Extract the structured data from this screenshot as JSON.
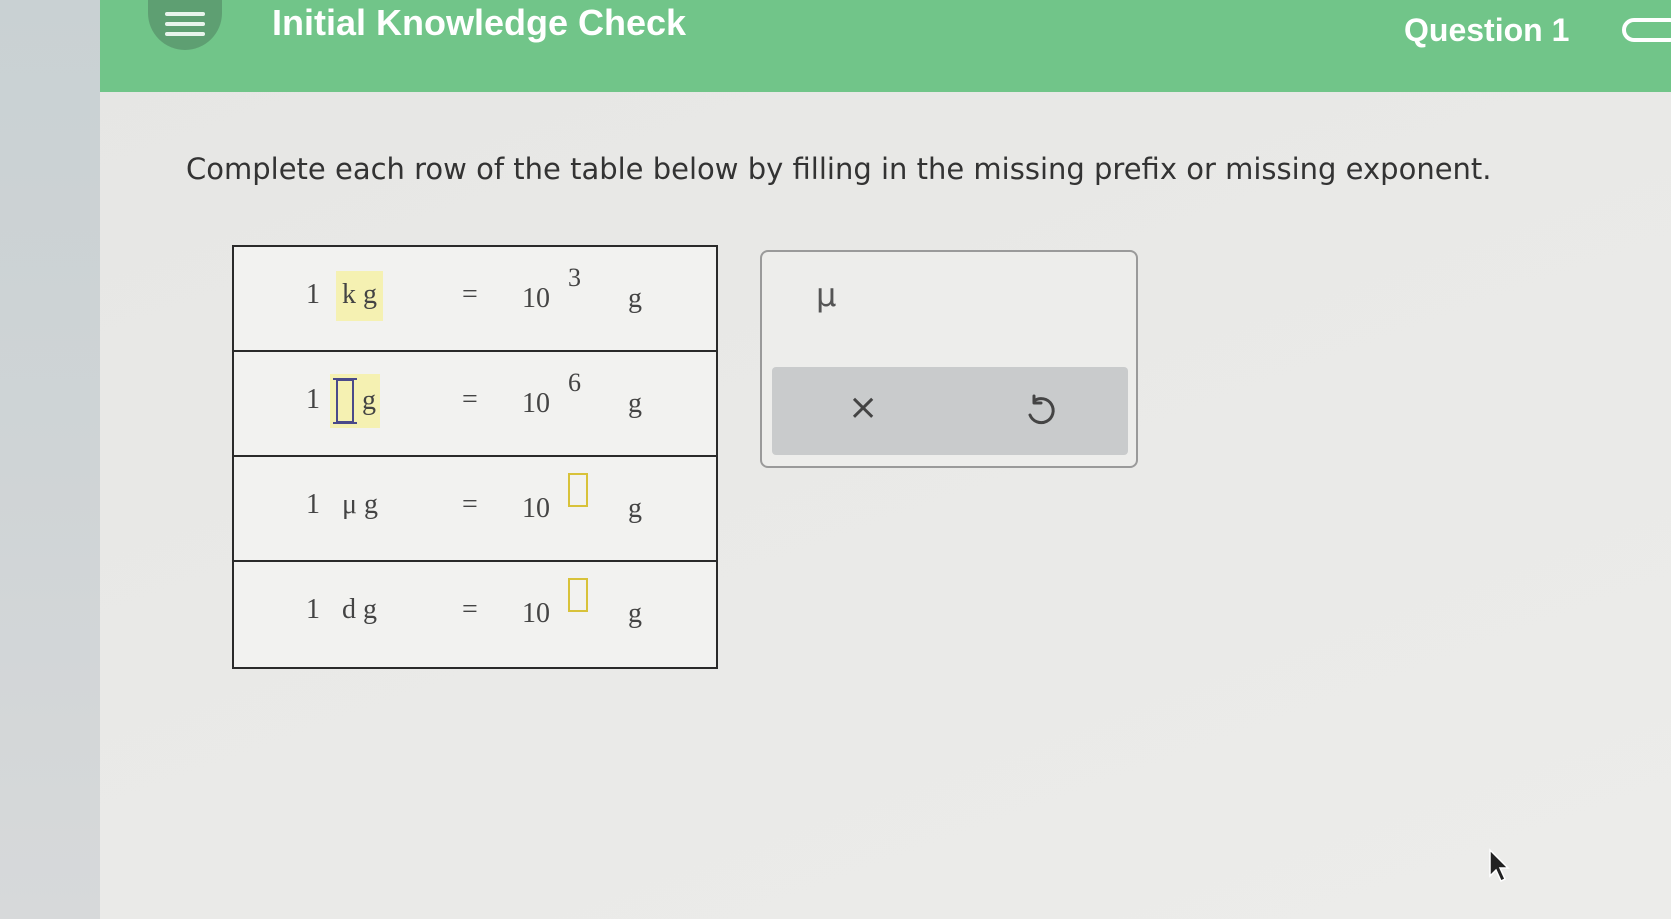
{
  "header": {
    "title": "Initial Knowledge Check",
    "question_label": "Question 1"
  },
  "prompt": "Complete each row of the table below by filling in the missing prefix or missing exponent.",
  "table": {
    "rows": [
      {
        "one": "1",
        "prefix": "k",
        "unit": "g",
        "eq": "=",
        "base": "10",
        "exponent": "3",
        "unit_right": "g"
      },
      {
        "one": "1",
        "prefix": "",
        "unit": "g",
        "eq": "=",
        "base": "10",
        "exponent": "6",
        "unit_right": "g"
      },
      {
        "one": "1",
        "prefix": "μ",
        "unit": "g",
        "eq": "=",
        "base": "10",
        "exponent": "",
        "unit_right": "g"
      },
      {
        "one": "1",
        "prefix": "d",
        "unit": "g",
        "eq": "=",
        "base": "10",
        "exponent": "",
        "unit_right": "g"
      }
    ]
  },
  "keypad": {
    "mu_key": "μ",
    "clear_key": "×",
    "undo_icon": "undo-icon"
  },
  "icons": {
    "menu": "menu-icon",
    "progress": "progress-pill-icon",
    "cursor": "mouse-pointer-icon"
  },
  "colors": {
    "header_green": "#71c589",
    "highlight_yellow": "#f5f1b2"
  }
}
